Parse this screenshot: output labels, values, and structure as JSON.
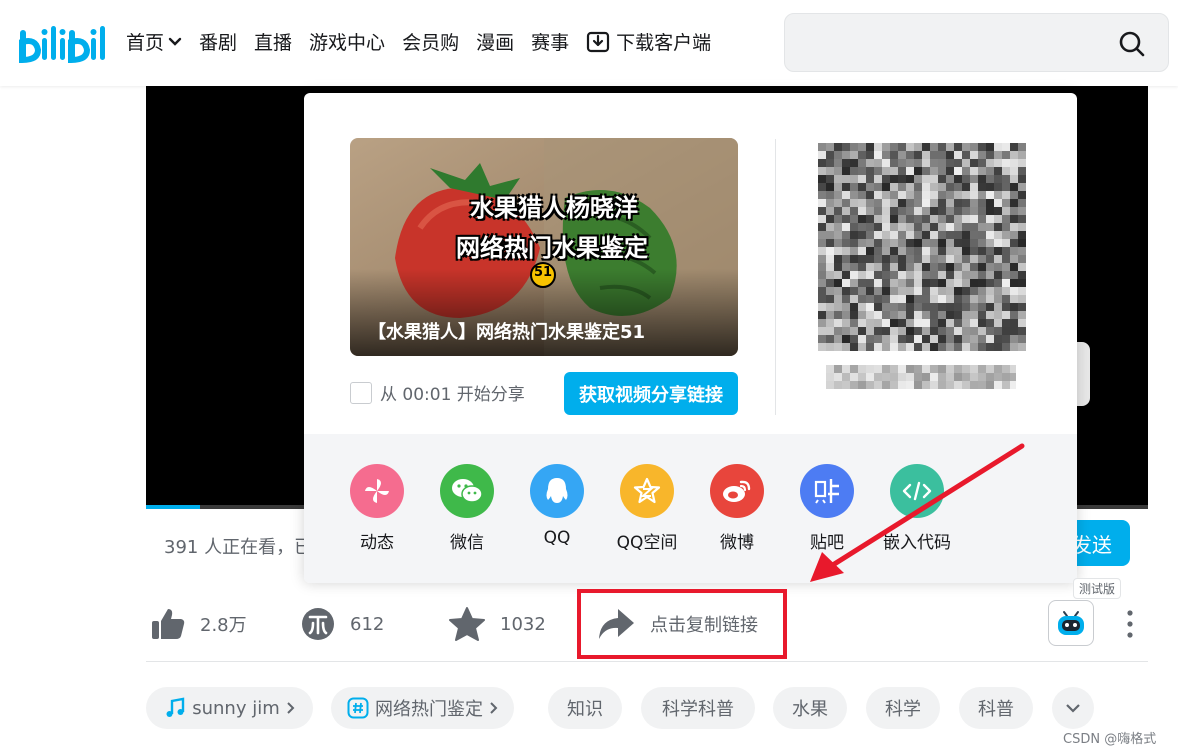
{
  "header": {
    "logo_text": "bilibili",
    "nav": [
      {
        "label": "首页",
        "has_dropdown": true
      },
      {
        "label": "番剧"
      },
      {
        "label": "直播"
      },
      {
        "label": "游戏中心"
      },
      {
        "label": "会员购"
      },
      {
        "label": "漫画"
      },
      {
        "label": "赛事"
      },
      {
        "label": "下载客户端",
        "icon": "download-icon"
      }
    ],
    "search": {
      "placeholder": "",
      "icon": "search-icon"
    }
  },
  "player": {
    "viewers_text": "391 人正在看，已",
    "send_label": "发送"
  },
  "share_popup": {
    "thumbnail": {
      "title_line1": "水果猎人杨晓洋",
      "title_line2": "网络热门水果鉴定",
      "episode_badge": "51",
      "caption": "【水果猎人】网络热门水果鉴定51"
    },
    "start_from_label": "从 00:01 开始分享",
    "get_link_button": "获取视频分享链接",
    "qr_caption": "",
    "targets": [
      {
        "label": "动态",
        "color": "#f56c8f",
        "icon": "pinwheel-icon"
      },
      {
        "label": "微信",
        "color": "#3fb94a",
        "icon": "wechat-icon"
      },
      {
        "label": "QQ",
        "color": "#35a6f4",
        "icon": "qq-icon"
      },
      {
        "label": "QQ空间",
        "color": "#f8b62b",
        "icon": "qzone-star-icon"
      },
      {
        "label": "微博",
        "color": "#e8453c",
        "icon": "weibo-icon"
      },
      {
        "label": "贴吧",
        "color": "#4d7cf3",
        "icon": "tieba-icon"
      },
      {
        "label": "嵌入代码",
        "color": "#3bbf9e",
        "icon": "code-icon"
      }
    ]
  },
  "actions": {
    "like_count": "2.8万",
    "coin_count": "612",
    "favorite_count": "1032",
    "share_label": "点击复制链接",
    "test_badge": "测试版"
  },
  "tags": [
    {
      "label": "sunny jim",
      "icon": "music-note-icon",
      "has_chevron": true
    },
    {
      "label": "网络热门鉴定",
      "icon": "hashtag-icon",
      "has_chevron": true
    },
    {
      "label": "知识"
    },
    {
      "label": "科学科普"
    },
    {
      "label": "水果"
    },
    {
      "label": "科学"
    },
    {
      "label": "科普"
    }
  ],
  "watermark": "CSDN @嗨格式",
  "colors": {
    "brand_blue": "#00aeec",
    "annotation_red": "#e8192c"
  }
}
